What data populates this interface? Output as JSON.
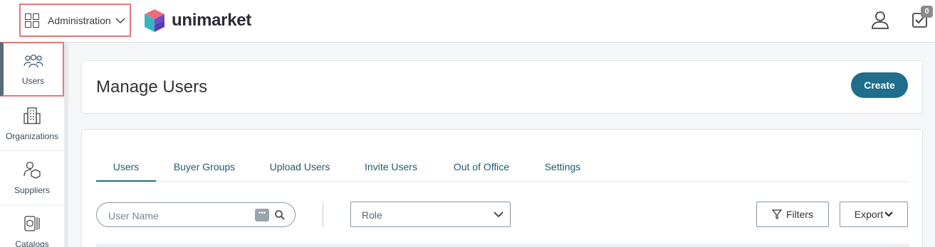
{
  "topbar": {
    "app_switcher_label": "Administration",
    "brand_name": "unimarket",
    "task_count": "0"
  },
  "sidebar": {
    "items": [
      {
        "label": "Users",
        "icon": "users-icon",
        "active": true
      },
      {
        "label": "Organizations",
        "icon": "building-icon",
        "active": false
      },
      {
        "label": "Suppliers",
        "icon": "supplier-icon",
        "active": false
      },
      {
        "label": "Catalogs",
        "icon": "catalog-icon",
        "active": false
      }
    ]
  },
  "header": {
    "title": "Manage Users",
    "create_label": "Create"
  },
  "tabs": [
    {
      "label": "Users",
      "active": true
    },
    {
      "label": "Buyer Groups",
      "active": false
    },
    {
      "label": "Upload Users",
      "active": false
    },
    {
      "label": "Invite Users",
      "active": false
    },
    {
      "label": "Out of Office",
      "active": false
    },
    {
      "label": "Settings",
      "active": false
    }
  ],
  "filters": {
    "search_placeholder": "User Name",
    "role_value": "Role",
    "filters_label": "Filters",
    "export_label": "Export"
  },
  "colors": {
    "accent": "#1e6e8c",
    "highlight_border": "#e3787b"
  }
}
